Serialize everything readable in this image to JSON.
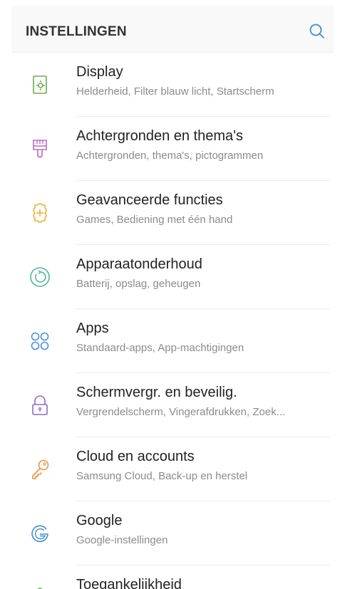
{
  "header": {
    "title": "INSTELLINGEN",
    "search_icon": "search-icon",
    "accent_color": "#3b8fd6"
  },
  "items": [
    {
      "title": "Display",
      "subtitle": "Helderheid, Filter blauw licht, Startscherm",
      "icon": "display-icon",
      "color": "#6cab46"
    },
    {
      "title": "Achtergronden en thema's",
      "subtitle": "Achtergronden, thema's, pictogrammen",
      "icon": "paintbrush-icon",
      "color": "#b86bc4"
    },
    {
      "title": "Geavanceerde functies",
      "subtitle": "Games, Bediening met één hand",
      "icon": "puzzle-gear-icon",
      "color": "#e9b33a"
    },
    {
      "title": "Apparaatonderhoud",
      "subtitle": "Batterij, opslag, geheugen",
      "icon": "device-care-icon",
      "color": "#4fb89d"
    },
    {
      "title": "Apps",
      "subtitle": "Standaard-apps, App-machtigingen",
      "icon": "apps-icon",
      "color": "#4a90d9"
    },
    {
      "title": "Schermvergr. en beveilig.",
      "subtitle": "Vergrendelscherm, Vingerafdrukken, Zoek...",
      "icon": "lock-icon",
      "color": "#8e6cc4"
    },
    {
      "title": "Cloud en accounts",
      "subtitle": "Samsung Cloud, Back-up en herstel",
      "icon": "key-icon",
      "color": "#e8914a"
    },
    {
      "title": "Google",
      "subtitle": "Google-instellingen",
      "icon": "google-icon",
      "color": "#3f8fd6"
    },
    {
      "title": "Toegankelijkheid",
      "subtitle": "",
      "icon": "accessibility-icon",
      "color": "#6cab46"
    }
  ]
}
